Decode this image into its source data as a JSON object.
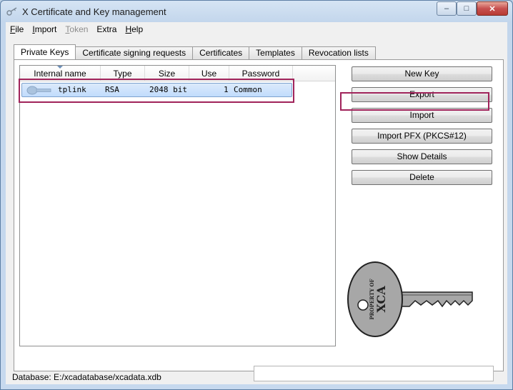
{
  "window": {
    "title": "X Certificate and Key management",
    "minimize_glyph": "–",
    "maximize_glyph": "□",
    "close_glyph": "✕"
  },
  "menu": {
    "items": [
      {
        "label": "File",
        "accel": "F",
        "rest": "ile",
        "enabled": true
      },
      {
        "label": "Import",
        "accel": "I",
        "rest": "mport",
        "enabled": true
      },
      {
        "label": "Token",
        "accel": "T",
        "rest": "oken",
        "enabled": false
      },
      {
        "label": "Extra",
        "accel": "",
        "rest": "Extra",
        "enabled": true
      },
      {
        "label": "Help",
        "accel": "H",
        "rest": "elp",
        "enabled": true
      }
    ]
  },
  "tabs": [
    {
      "label": "Private Keys",
      "active": true
    },
    {
      "label": "Certificate signing requests",
      "active": false
    },
    {
      "label": "Certificates",
      "active": false
    },
    {
      "label": "Templates",
      "active": false
    },
    {
      "label": "Revocation lists",
      "active": false
    }
  ],
  "keys_table": {
    "columns": [
      "Internal name",
      "Type",
      "Size",
      "Use",
      "Password"
    ],
    "rows": [
      {
        "name": "tplink",
        "type": "RSA",
        "size": "2048 bit",
        "use": "1",
        "password": "Common",
        "selected": true
      }
    ]
  },
  "buttons": {
    "new_key": "New Key",
    "export": "Export",
    "import": "Import",
    "import_pfx": "Import PFX (PKCS#12)",
    "show_details": "Show Details",
    "delete": "Delete"
  },
  "key_image": {
    "text_line1": "PROPERTY OF",
    "text_line2": "XCA"
  },
  "status": {
    "database": "Database: E:/xcadatabase/xcadata.xdb"
  },
  "colors": {
    "highlight_box": "#a0235a",
    "selection": "#c1dcfc"
  }
}
